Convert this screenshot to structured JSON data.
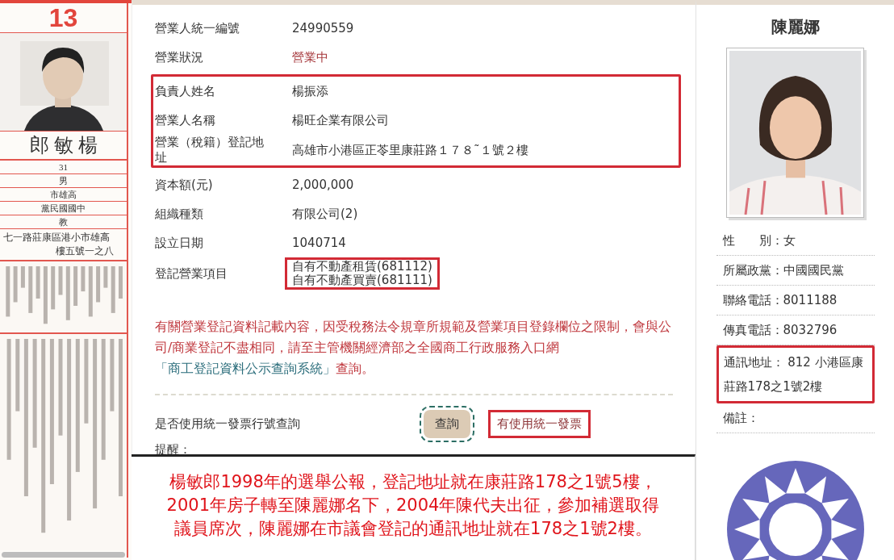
{
  "bulletin": {
    "number": "13",
    "name": "郎 敏 楊",
    "rows": [
      "31",
      "男",
      "市雄高",
      "黨民國國中",
      "教"
    ],
    "address_lines": [
      "七一路莊康區港小市雄高",
      "樓五號一之八"
    ]
  },
  "business": {
    "groups": [
      {
        "highlighted": false,
        "rows": [
          {
            "label": "營業人統一編號",
            "kind": "plain",
            "values": [
              "24990559"
            ],
            "value_highlighted": false
          },
          {
            "label": "營業狀況",
            "kind": "status",
            "values": [
              "營業中"
            ],
            "value_highlighted": false
          }
        ]
      },
      {
        "highlighted": true,
        "rows": [
          {
            "label": "負責人姓名",
            "kind": "plain",
            "values": [
              "楊振添"
            ],
            "value_highlighted": false
          },
          {
            "label": "營業人名稱",
            "kind": "plain",
            "values": [
              "楊旺企業有限公司"
            ],
            "value_highlighted": false
          },
          {
            "label": "營業（稅籍）登記地址",
            "kind": "plain",
            "values": [
              "高雄市小港區正苓里康莊路１７８˜１號２樓"
            ],
            "value_highlighted": false
          }
        ]
      },
      {
        "highlighted": false,
        "rows": [
          {
            "label": "資本額(元)",
            "kind": "plain",
            "values": [
              "2,000,000"
            ],
            "value_highlighted": false
          },
          {
            "label": "組織種類",
            "kind": "plain",
            "values": [
              "有限公司(2)"
            ],
            "value_highlighted": false
          },
          {
            "label": "設立日期",
            "kind": "plain",
            "values": [
              "1040714"
            ],
            "value_highlighted": false
          },
          {
            "label": "登記營業項目",
            "kind": "list",
            "values": [
              "自有不動產租賃(681112)",
              "自有不動產買賣(681111)"
            ],
            "value_highlighted": true
          }
        ]
      }
    ],
    "notice": {
      "text": "有關營業登記資料記載內容，因受稅務法令規章所規範及營業項目登錄欄位之限制，會與公司/商業登記不盡相同，請至主管機關經濟部之全國商工行政服務入口網",
      "link": "「商工登記資料公示查詢系統」",
      "text_after": "查詢。"
    },
    "invoice": {
      "label": "是否使用統一發票行號查詢",
      "button": "查詢",
      "result": "有使用統一發票",
      "result_highlighted": true
    },
    "reminder": "提醒："
  },
  "note": {
    "lines": [
      "楊敏郎1998年的選舉公報，登記地址就在康莊路178之1號5樓，",
      "2001年房子轉至陳麗娜名下，2004年陳代夫出征，參加補選取得",
      "議員席次，陳麗娜在市議會登記的通訊地址就在178之1號2樓。"
    ]
  },
  "profile": {
    "name": "陳麗娜",
    "fields": [
      {
        "label": "性　　別：",
        "value": "女",
        "highlighted": false
      },
      {
        "label": "所屬政黨：",
        "value": "中國國民黨",
        "highlighted": false
      },
      {
        "label": "聯絡電話：",
        "value": "8011188",
        "highlighted": false
      },
      {
        "label": "傳真電話：",
        "value": "8032796",
        "highlighted": false
      },
      {
        "label": "通訊地址：",
        "value": " 812 小港區康莊路178之1號2樓",
        "highlighted": true
      },
      {
        "label": "備註：",
        "highlighted": false
      }
    ]
  }
}
